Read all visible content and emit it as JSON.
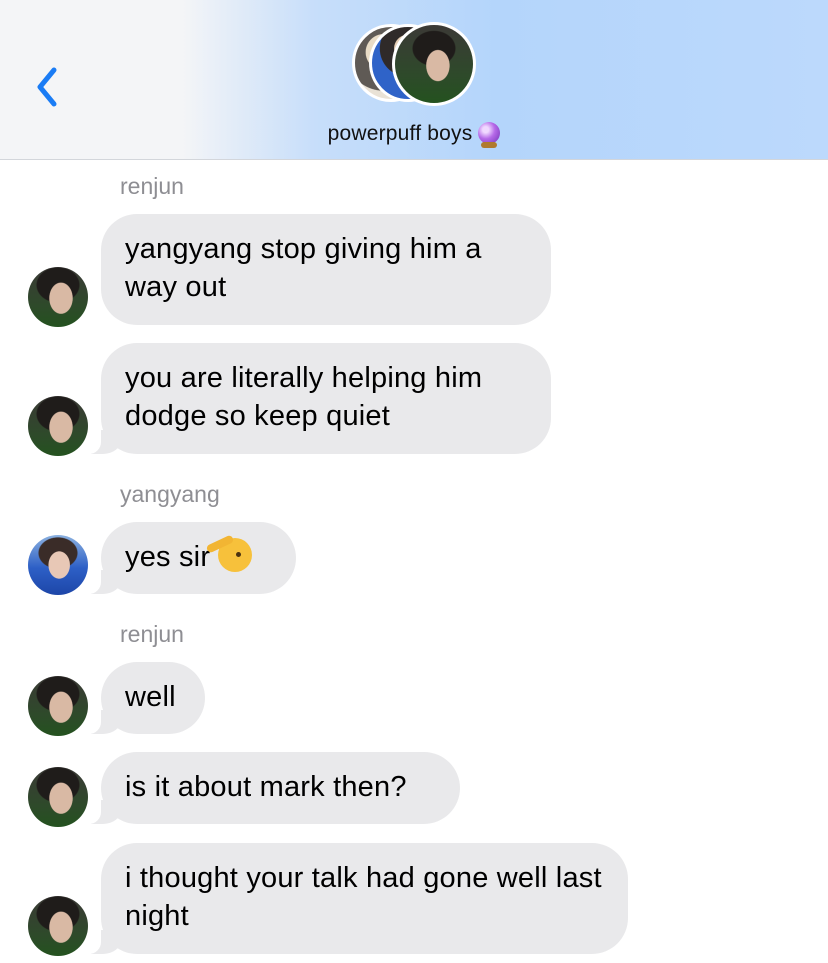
{
  "header": {
    "back_label": "<",
    "group_name": "powerpuff boys",
    "group_icon": "crystal-ball-icon"
  },
  "messages": [
    {
      "sender": "renjun",
      "text": "yangyang stop giving him a way out"
    },
    {
      "sender": "renjun",
      "text": "you are literally helping him dodge so keep quiet"
    },
    {
      "sender": "yangyang",
      "text": "yes sir",
      "emoji": "saluting-face-icon"
    },
    {
      "sender": "renjun",
      "text": "well"
    },
    {
      "sender": "renjun",
      "text": "is it about mark then?"
    },
    {
      "sender": "renjun",
      "text": "i thought your talk had gone well last night"
    }
  ],
  "colors": {
    "bubble": "#e9e9eb",
    "accent": "#1a7cf5",
    "sender_label": "#8e8e93"
  }
}
